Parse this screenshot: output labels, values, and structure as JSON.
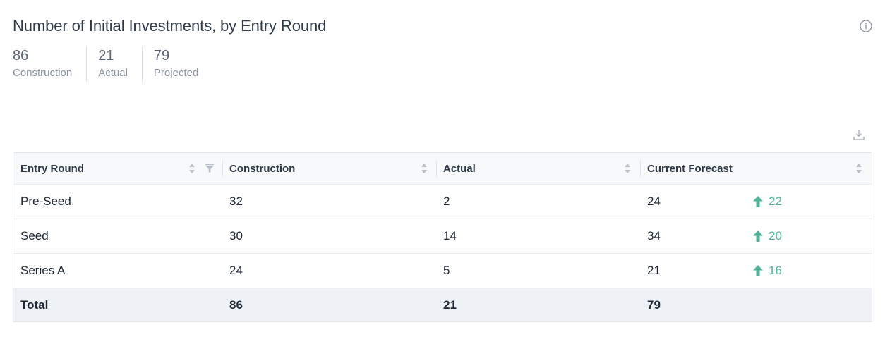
{
  "widget": {
    "title": "Number of Initial Investments, by Entry Round",
    "info_icon": "info-icon",
    "download_icon": "download-icon"
  },
  "stats": [
    {
      "value": "86",
      "label": "Construction"
    },
    {
      "value": "21",
      "label": "Actual"
    },
    {
      "value": "79",
      "label": "Projected"
    }
  ],
  "table": {
    "columns": [
      "Entry Round",
      "Construction",
      "Actual",
      "Current Forecast"
    ],
    "rows": [
      {
        "round": "Pre-Seed",
        "construction": "32",
        "actual": "2",
        "forecast": "24",
        "delta": "22"
      },
      {
        "round": "Seed",
        "construction": "30",
        "actual": "14",
        "forecast": "34",
        "delta": "20"
      },
      {
        "round": "Series A",
        "construction": "24",
        "actual": "5",
        "forecast": "21",
        "delta": "16"
      }
    ],
    "total": {
      "label": "Total",
      "construction": "86",
      "actual": "21",
      "forecast": "79"
    }
  },
  "colors": {
    "accent_up": "#4fb39c",
    "header_bg": "#f7f9fb",
    "total_bg": "#eef2f7"
  }
}
